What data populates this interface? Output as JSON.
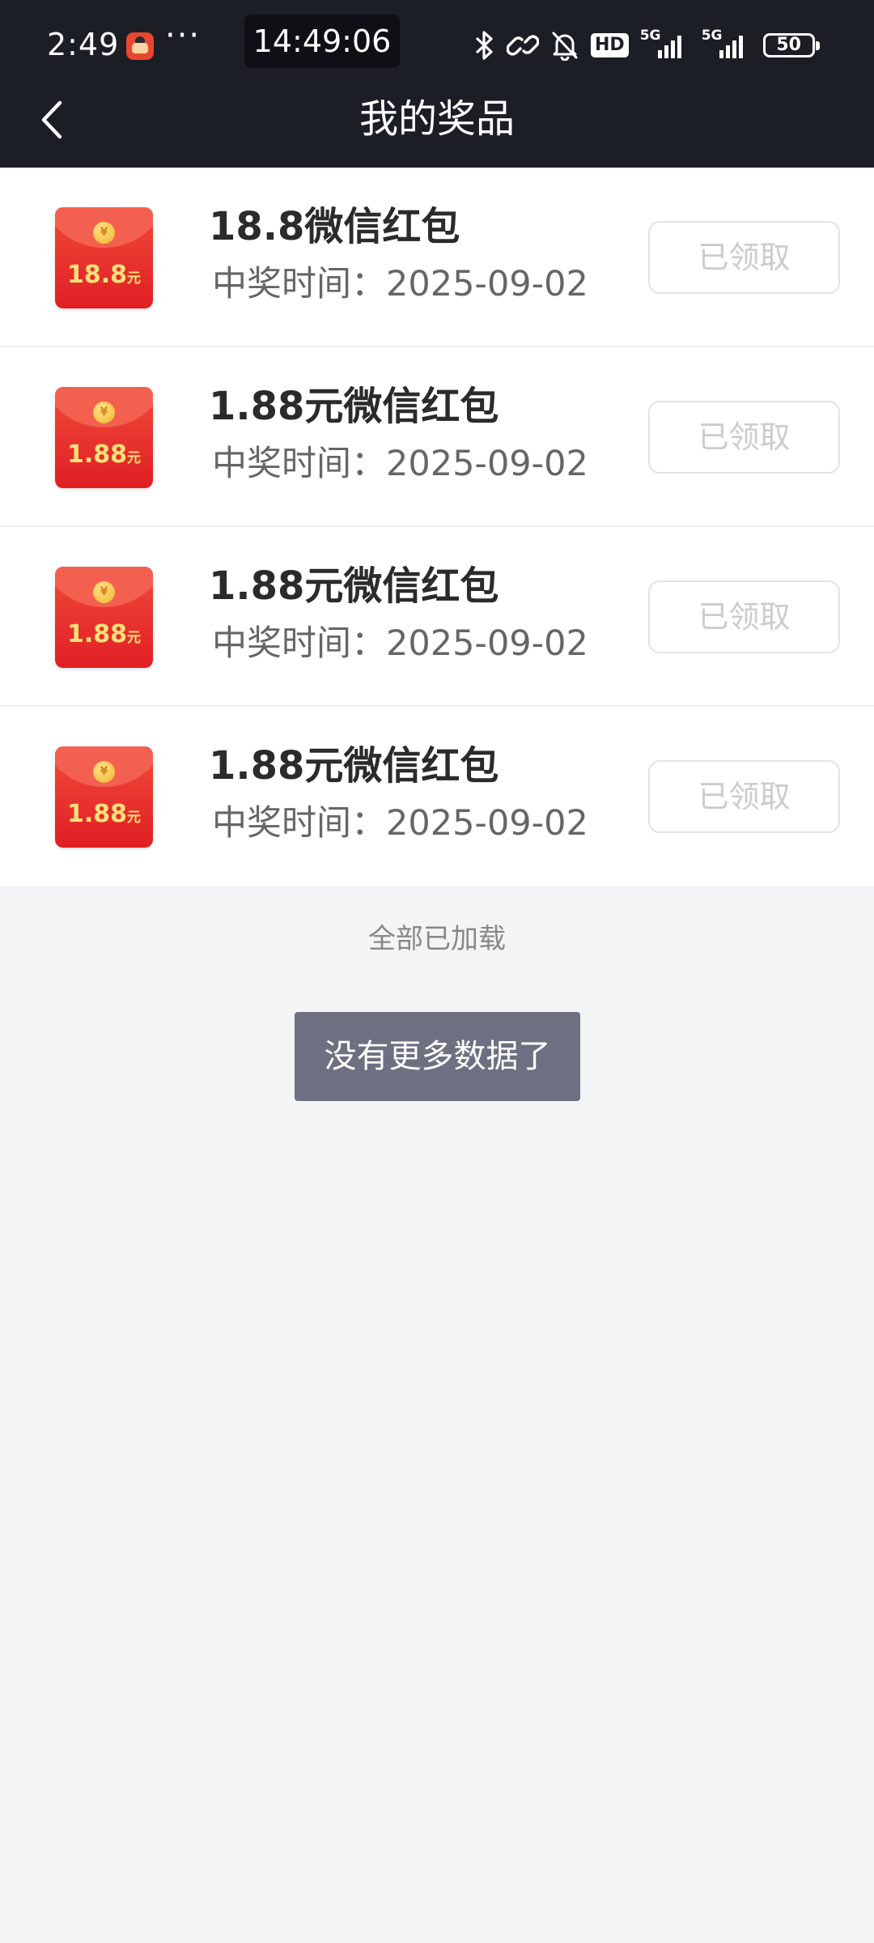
{
  "status_bar": {
    "time": "2:49",
    "more": "···",
    "clock": "14:49:06",
    "hd_label": "HD",
    "network_label": "5G",
    "battery": "50"
  },
  "nav": {
    "title": "我的奖品"
  },
  "prizes": [
    {
      "amount": "18.8",
      "unit": "元",
      "title": "18.8微信红包",
      "time_text": "中奖时间：2025-09-02",
      "status": "已领取"
    },
    {
      "amount": "1.88",
      "unit": "元",
      "title": "1.88元微信红包",
      "time_text": "中奖时间：2025-09-02",
      "status": "已领取"
    },
    {
      "amount": "1.88",
      "unit": "元",
      "title": "1.88元微信红包",
      "time_text": "中奖时间：2025-09-02",
      "status": "已领取"
    },
    {
      "amount": "1.88",
      "unit": "元",
      "title": "1.88元微信红包",
      "time_text": "中奖时间：2025-09-02",
      "status": "已领取"
    }
  ],
  "footer": {
    "loaded_text": "全部已加载",
    "toast_text": "没有更多数据了"
  },
  "colors": {
    "header_bg": "#1c1e26",
    "page_bg": "#f3f4f6",
    "envelope_red": "#e01f24",
    "toast_bg": "#6c7080"
  }
}
